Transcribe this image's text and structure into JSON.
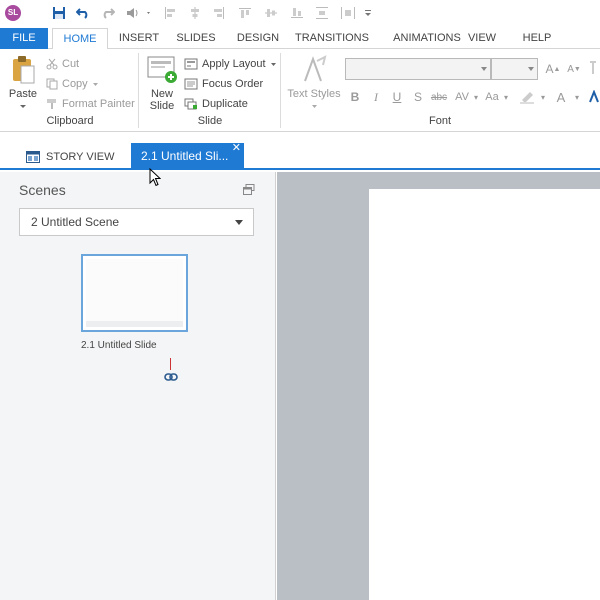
{
  "app": {
    "logo_text": "SL"
  },
  "ribbon_tabs": [
    "FILE",
    "HOME",
    "INSERT",
    "SLIDES",
    "DESIGN",
    "TRANSITIONS",
    "ANIMATIONS",
    "VIEW",
    "HELP"
  ],
  "clipboard": {
    "paste": "Paste",
    "cut": "Cut",
    "copy": "Copy",
    "format_painter": "Format Painter",
    "label": "Clipboard"
  },
  "slide_group": {
    "new_slide": "New Slide",
    "apply_layout": "Apply Layout",
    "focus_order": "Focus Order",
    "duplicate": "Duplicate",
    "label": "Slide"
  },
  "font_group": {
    "text_styles": "Text Styles",
    "label": "Font",
    "font_name_value": "",
    "font_size_value": ""
  },
  "doc_tabs": {
    "story_view": "STORY VIEW",
    "active_slide": "2.1 Untitled Sli..."
  },
  "scenes": {
    "title": "Scenes",
    "selected_scene": "2 Untitled Scene",
    "slides": [
      {
        "label": "2.1 Untitled Slide"
      }
    ]
  },
  "colors": {
    "accent": "#1f7ad4",
    "panel_bg": "#f4f5f6",
    "canvas_bg": "#b9bfc4"
  }
}
